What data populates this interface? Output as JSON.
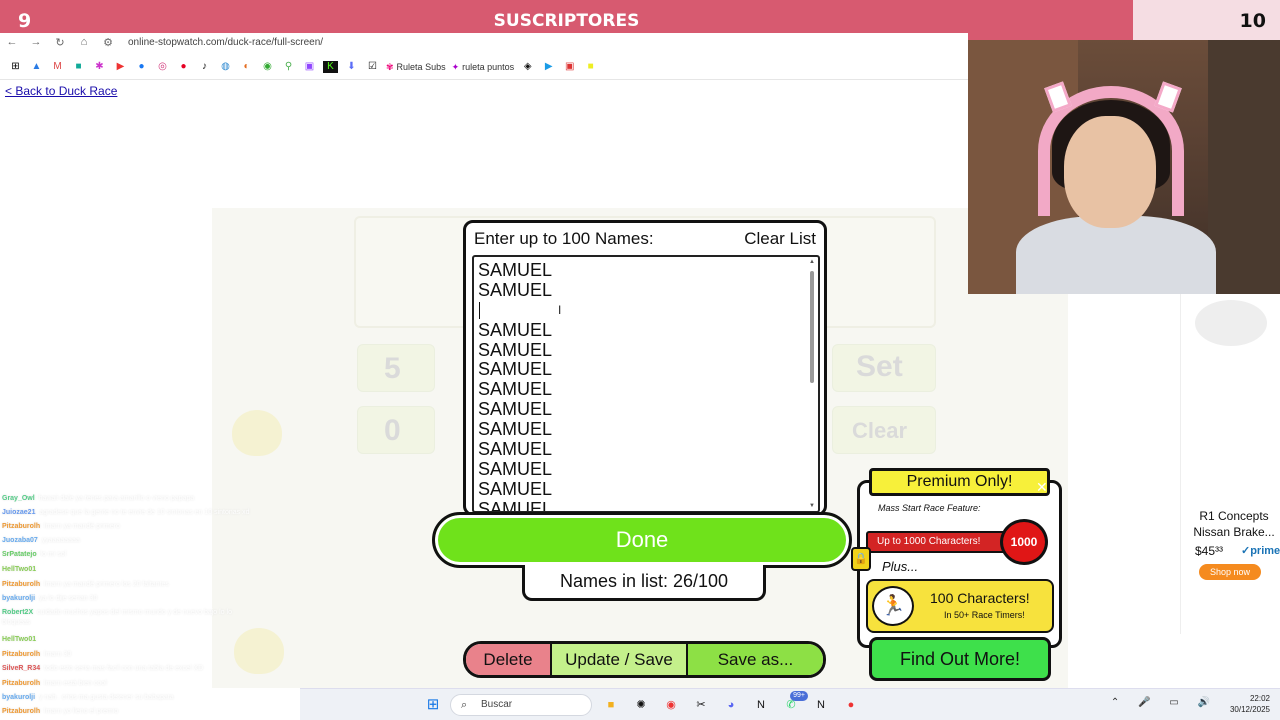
{
  "banner": {
    "current": "9",
    "title": "SUSCRIPTORES",
    "goal": "10"
  },
  "browser": {
    "url": "online-stopwatch.com/duck-race/full-screen/",
    "bookmarks": [
      "Ruleta Subs",
      "ruleta puntos"
    ]
  },
  "page": {
    "back_link": "< Back to Duck Race"
  },
  "stopwatch_ghost": {
    "top_left": "5",
    "bottom_left": "0",
    "set": "Set",
    "clear": "Clear"
  },
  "modal": {
    "heading": "Enter up to 100 Names:",
    "clear_list": "Clear List",
    "names": [
      "SAMUEL",
      "SAMUEL",
      "",
      "SAMUEL",
      "SAMUEL",
      "SAMUEL",
      "SAMUEL",
      "SAMUEL",
      "SAMUEL",
      "SAMUEL",
      "SAMUEL",
      "SAMUEL",
      "SAMUEL"
    ],
    "done": "Done",
    "count": "Names in list: 26/100"
  },
  "actions": {
    "delete": "Delete",
    "update": "Update / Save",
    "save_as": "Save as..."
  },
  "premium": {
    "title": "Premium Only!",
    "mass_start": "Mass Start Race Feature:",
    "up_to": "Up to 1000 Characters!",
    "badge": "1000",
    "plus": "Plus...",
    "chars_title": "100 Characters!",
    "chars_sub": "In 50+ Race Timers!",
    "find_out": "Find Out More!"
  },
  "ad": {
    "title": "R1 Concepts Nissan Brake...",
    "price": "$45³³",
    "prime": "✓prime",
    "shop": "Shop now"
  },
  "chat": [
    {
      "user": "Gray_Owl",
      "text": ": hawaii dale ya tenes para amarillo o vieno papapa"
    },
    {
      "user": "Juiozae21",
      "text": ": agradese que la gente no te envie de 10 sintonas en 10 sintonas xd"
    },
    {
      "user": "Pitzaburolh",
      "text": ": lmarn ya mandé primero"
    },
    {
      "user": "Juozaba07",
      "text": ": yyaaaaaaaa"
    },
    {
      "user": "SrPatatejo",
      "text": ": lo mi sol"
    },
    {
      "user": "HellTwo01",
      "text": ":"
    },
    {
      "user": "Pitzaburolh",
      "text": ": lmarn ya mandé primero los 20 faltantes"
    },
    {
      "user": "byakurolji",
      "text": ": ya lo dije serian 30"
    },
    {
      "user": "Robert2X",
      "text": ": cuidado muchos yapos del mismo mundo y de nuevo bajo lo lo"
    },
    {
      "user": "",
      "text": "bloqueas"
    },
    {
      "user": "HellTwo01",
      "text": ":"
    },
    {
      "user": "Pitzaburolh",
      "text": ": lmarn 30"
    },
    {
      "user": "SilveR_R34",
      "text": ": todo esto seria mas facil con una tabla de excel XD"
    },
    {
      "user": "Pitzaburolh",
      "text": ": lmarn está bien cool"
    },
    {
      "user": "byakurolji",
      "text": ": y nah.. crios ma gusta detener su babapata"
    },
    {
      "user": "Pitzaburolh",
      "text": ": lmarn yo lleno el premio"
    }
  ],
  "taskbar": {
    "search": "Buscar",
    "time": "22:02",
    "date": "30/12/2025",
    "badge": "99+"
  }
}
